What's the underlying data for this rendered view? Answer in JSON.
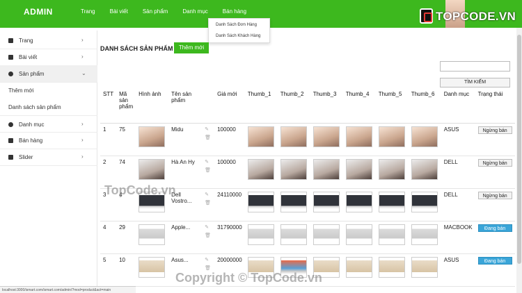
{
  "app": {
    "brand": "ADMIN"
  },
  "topnav": [
    "Trang",
    "Bài viết",
    "Sản phẩm",
    "Danh mục",
    "Bán hàng"
  ],
  "dropdown": [
    "Danh Sách Đơn Hàng",
    "Danh Sách Khách Hàng"
  ],
  "logo": {
    "text": "TOPCODE.VN"
  },
  "sidebar": {
    "items": [
      {
        "label": "Trang",
        "icon": "map-icon"
      },
      {
        "label": "Bài viết",
        "icon": "edit-icon"
      },
      {
        "label": "Sản phẩm",
        "icon": "product-icon"
      },
      {
        "label": "Danh mục",
        "icon": "category-icon"
      },
      {
        "label": "Bán hàng",
        "icon": "database-icon"
      },
      {
        "label": "Slider",
        "icon": "sliders-icon"
      }
    ],
    "sub": [
      "Thêm mới",
      "Danh sách sản phẩm"
    ]
  },
  "main": {
    "title": "DANH SÁCH SẢN PHẨM",
    "add_label": "Thêm mới",
    "search_label": "TÌM KIẾM"
  },
  "table": {
    "headers": [
      "STT",
      "Mã sản phẩm",
      "Hình ảnh",
      "Tên sản phẩm",
      "",
      "Giá mới",
      "Thumb_1",
      "Thumb_2",
      "Thumb_3",
      "Thumb_4",
      "Thumb_5",
      "Thumb_6",
      "Danh mục",
      "Trạng thái"
    ],
    "rows": [
      {
        "stt": "1",
        "id": "75",
        "name": "Midu",
        "price": "100000",
        "category": "ASUS",
        "status": "Ngừng bán",
        "on": false,
        "kind": "photo"
      },
      {
        "stt": "2",
        "id": "74",
        "name": "Hà An Hy",
        "price": "100000",
        "category": "DELL",
        "status": "Ngừng bán",
        "on": false,
        "kind": "photo2"
      },
      {
        "stt": "3",
        "id": "4",
        "name": "Dell Vostro...",
        "price": "24110000",
        "category": "DELL",
        "status": "Ngừng bán",
        "on": false,
        "kind": "laptop"
      },
      {
        "stt": "4",
        "id": "29",
        "name": "Apple...",
        "price": "31790000",
        "category": "MACBOOK",
        "status": "Đang bán",
        "on": true,
        "kind": "silver"
      },
      {
        "stt": "5",
        "id": "10",
        "name": "Asus...",
        "price": "20000000",
        "category": "ASUS",
        "status": "Đang bán",
        "on": true,
        "kind": "gold"
      }
    ]
  },
  "statusbar": "localhost:3000/ismart.com/ismart.com/admin/?mod=product&act=main",
  "watermarks": [
    "TopCode.vn",
    "Copyright © TopCode.vn"
  ],
  "colors": {
    "primary": "#3db81e",
    "status_on": "#3aa5d8"
  }
}
